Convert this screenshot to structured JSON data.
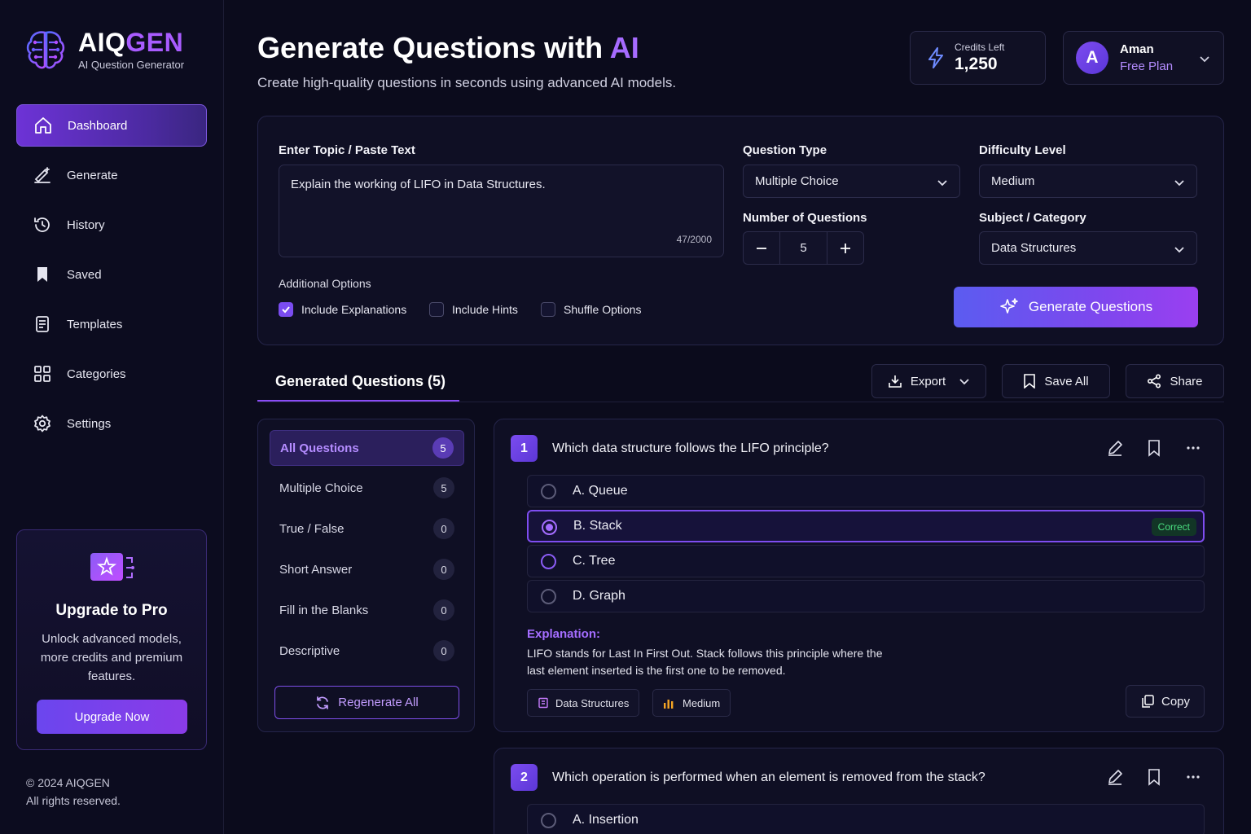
{
  "brand": {
    "name_prefix": "AIQ",
    "name_suffix": "GEN",
    "subtitle": "AI Question Generator"
  },
  "sidebar": {
    "items": [
      {
        "label": "Dashboard",
        "icon": "home-icon",
        "active": true
      },
      {
        "label": "Generate",
        "icon": "magic-pen-icon"
      },
      {
        "label": "History",
        "icon": "history-icon"
      },
      {
        "label": "Saved",
        "icon": "bookmark-icon"
      },
      {
        "label": "Templates",
        "icon": "document-icon"
      },
      {
        "label": "Categories",
        "icon": "grid-icon"
      },
      {
        "label": "Settings",
        "icon": "gear-icon"
      }
    ],
    "upgrade": {
      "title": "Upgrade to Pro",
      "description": "Unlock advanced models, more credits and premium features.",
      "button": "Upgrade Now"
    },
    "footer": {
      "copyright": "© 2024 AIQGEN",
      "rights": "All rights reserved."
    }
  },
  "header": {
    "title_prefix": "Generate Questions with ",
    "title_accent": "AI",
    "subtitle": "Create high-quality questions in seconds using advanced AI models.",
    "credits_label": "Credits Left",
    "credits_value": "1,250",
    "user_initial": "A",
    "user_name": "Aman",
    "user_plan": "Free Plan"
  },
  "form": {
    "topic_label": "Enter Topic / Paste Text",
    "topic_value": "Explain the working of LIFO in Data Structures.",
    "topic_counter": "47/2000",
    "question_type_label": "Question Type",
    "question_type_value": "Multiple Choice",
    "difficulty_label": "Difficulty Level",
    "difficulty_value": "Medium",
    "number_label": "Number of Questions",
    "number_value": "5",
    "subject_label": "Subject / Category",
    "subject_value": "Data Structures",
    "options_title": "Additional Options",
    "options": [
      {
        "label": "Include Explanations",
        "checked": true
      },
      {
        "label": "Include Hints",
        "checked": false
      },
      {
        "label": "Shuffle Options",
        "checked": false
      }
    ],
    "generate_button": "Generate Questions"
  },
  "results": {
    "tab_label": "Generated Questions (5)",
    "export_label": "Export",
    "save_all_label": "Save All",
    "share_label": "Share"
  },
  "filters": {
    "items": [
      {
        "label": "All Questions",
        "count": "5",
        "active": true
      },
      {
        "label": "Multiple Choice",
        "count": "5"
      },
      {
        "label": "True / False",
        "count": "0"
      },
      {
        "label": "Short Answer",
        "count": "0"
      },
      {
        "label": "Fill in the Blanks",
        "count": "0"
      },
      {
        "label": "Descriptive",
        "count": "0"
      }
    ],
    "regenerate_label": "Regenerate All"
  },
  "questions": [
    {
      "number": "1",
      "text": "Which data structure follows the LIFO principle?",
      "options": [
        "A. Queue",
        "B. Stack",
        "C. Tree",
        "D. Graph"
      ],
      "correct_badge": "Correct",
      "explanation_title": "Explanation:",
      "explanation": "LIFO stands for Last In First Out. Stack follows this principle where the last element inserted is the first one to be removed.",
      "tag_subject": "Data Structures",
      "tag_difficulty": "Medium",
      "copy_label": "Copy"
    },
    {
      "number": "2",
      "text": "Which operation is performed when an element is removed from the stack?",
      "options": [
        "A. Insertion"
      ]
    }
  ],
  "colors": {
    "accent": "#a95cff",
    "background": "#0b0b1c",
    "correct": "#4ade80"
  }
}
